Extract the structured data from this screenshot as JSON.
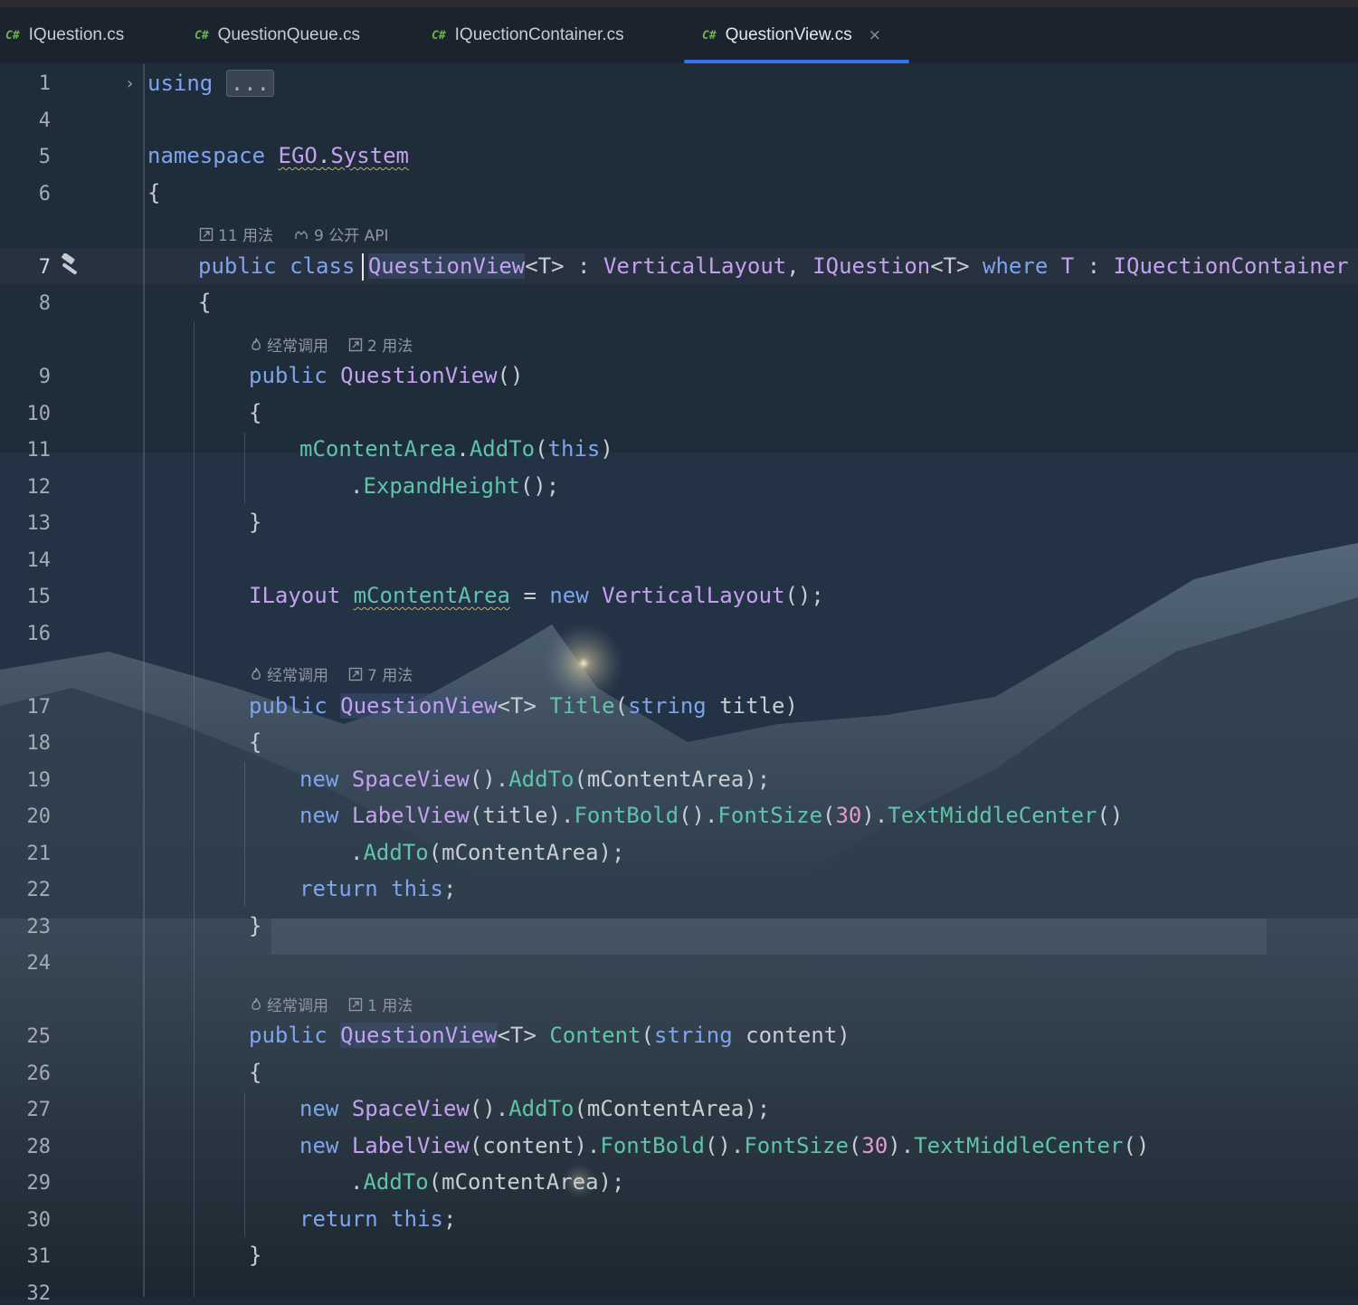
{
  "tabs": [
    {
      "lang": "C#",
      "name": "IQuestion.cs"
    },
    {
      "lang": "C#",
      "name": "QuestionQueue.cs"
    },
    {
      "lang": "C#",
      "name": "IQuectionContainer.cs"
    },
    {
      "lang": "C#",
      "name": "QuestionView.cs",
      "active": true,
      "close": "×"
    }
  ],
  "line_numbers": [
    "1",
    "4",
    "5",
    "6",
    "7",
    "8",
    "9",
    "10",
    "11",
    "12",
    "13",
    "14",
    "15",
    "16",
    "17",
    "18",
    "19",
    "20",
    "21",
    "22",
    "23",
    "24",
    "25",
    "26",
    "27",
    "28",
    "29",
    "30",
    "31",
    "32"
  ],
  "hints": {
    "class_usages": "11 用法",
    "class_api": "9 公开 API",
    "frequent": "经常调用",
    "ctor_usages": "2 用法",
    "title_usages": "7 用法",
    "content_usages": "1 用法"
  },
  "code": {
    "l1_kw": "using",
    "l1_fold": "...",
    "l5_kw": "namespace",
    "l5_ns1": "EGO",
    "l5_dot": ".",
    "l5_ns2": "System",
    "brace_open": "{",
    "brace_close": "}",
    "l7_public": "public",
    "l7_class": "class",
    "l7_name": "QuestionView",
    "l7_generic": "<T>",
    "l7_colon": " : ",
    "l7_base": "VerticalLayout",
    "l7_comma": ", ",
    "l7_iface": "IQuestion",
    "l7_where": "where",
    "l7_T": "T",
    "l7_iface2": "IQuectionContainer",
    "l9_public": "public",
    "l9_name": "QuestionView",
    "parens": "()",
    "l11_field": "mContentArea",
    "dot": ".",
    "l11_fn": "AddTo",
    "l11_arg": "this",
    "l12_fn": "ExpandHeight",
    "l12_end": "();",
    "l15_type": "ILayout",
    "l15_field": "mContentArea",
    "l15_eq": " = ",
    "l15_new": "new",
    "l15_ctor": "VerticalLayout",
    "l15_end": "();",
    "l17_public": "public",
    "l17_type": "QuestionView",
    "l17_gen": "<T>",
    "l17_fn": "Title",
    "l17_string": "string",
    "l17_param": "title",
    "l19_new": "new",
    "l19_type": "SpaceView",
    "l19_fn": "AddTo",
    "l19_arg": "mContentArea",
    "l19_end": ");",
    "l20_new": "new",
    "l20_type": "LabelView",
    "l20_arg": "title",
    "l20_fn1": "FontBold",
    "l20_fn2": "FontSize",
    "l20_num": "30",
    "l20_fn3": "TextMiddleCenter",
    "l21_fn": "AddTo",
    "l21_arg": "mContentArea",
    "l21_end": ");",
    "l22_return": "return",
    "l22_this": "this",
    "l22_end": ";",
    "l25_public": "public",
    "l25_type": "QuestionView",
    "l25_gen": "<T>",
    "l25_fn": "Content",
    "l25_string": "string",
    "l25_param": "content",
    "l27_new": "new",
    "l27_type": "SpaceView",
    "l27_fn": "AddTo",
    "l27_arg": "mContentArea",
    "l27_end": ");",
    "l28_new": "new",
    "l28_type": "LabelView",
    "l28_arg": "content",
    "l28_fn1": "FontBold",
    "l28_fn2": "FontSize",
    "l28_num": "30",
    "l28_fn3": "TextMiddleCenter",
    "l29_fn": "AddTo",
    "l29_arg": "mContentArea",
    "l29_end": ");",
    "l30_return": "return",
    "l30_this": "this",
    "l30_end": ";"
  },
  "colors": {
    "keyword": "#7da4ee",
    "type": "#c6a0f0",
    "method": "#5fc4a8",
    "number": "#e39ad0",
    "tab_accent": "#3574f0"
  }
}
